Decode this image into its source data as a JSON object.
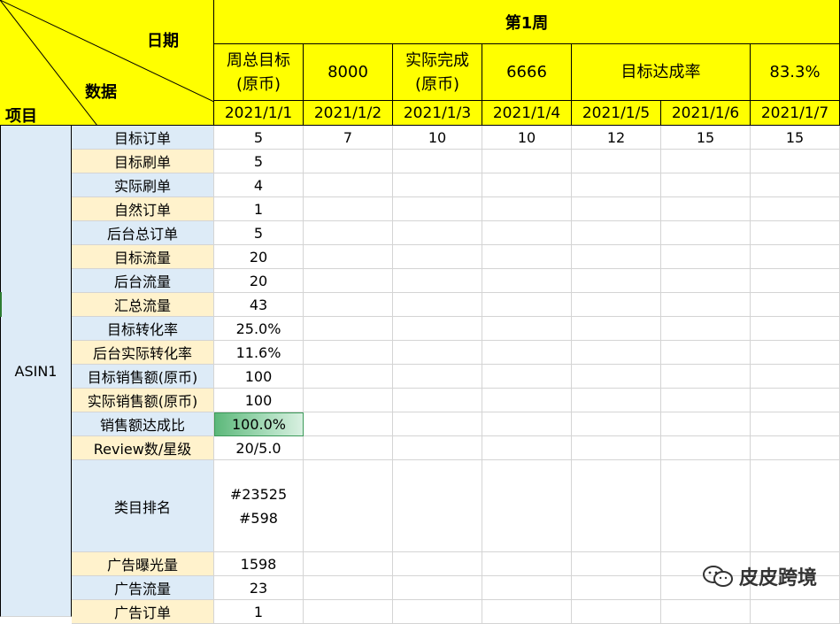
{
  "header": {
    "date_label": "日期",
    "data_label": "数据",
    "project_label": "项目",
    "week_title": "第1周",
    "summary": [
      {
        "label": "周总目标\n(原币)",
        "value": "8000"
      },
      {
        "label": "实际完成\n(原币)",
        "value": "6666"
      },
      {
        "label": "目标达成率",
        "value": "83.3%"
      }
    ],
    "dates": [
      "2021/1/1",
      "2021/1/2",
      "2021/1/3",
      "2021/1/4",
      "2021/1/5",
      "2021/1/6",
      "2021/1/7"
    ]
  },
  "asin_label": "ASIN1",
  "rows": [
    {
      "label": "目标订单",
      "values": [
        "5",
        "7",
        "10",
        "10",
        "12",
        "15",
        "15"
      ]
    },
    {
      "label": "目标刷单",
      "values": [
        "5",
        "",
        "",
        "",
        "",
        "",
        ""
      ]
    },
    {
      "label": "实际刷单",
      "values": [
        "4",
        "",
        "",
        "",
        "",
        "",
        ""
      ]
    },
    {
      "label": "自然订单",
      "values": [
        "1",
        "",
        "",
        "",
        "",
        "",
        ""
      ]
    },
    {
      "label": "后台总订单",
      "values": [
        "5",
        "",
        "",
        "",
        "",
        "",
        ""
      ]
    },
    {
      "label": "目标流量",
      "values": [
        "20",
        "",
        "",
        "",
        "",
        "",
        ""
      ]
    },
    {
      "label": "后台流量",
      "values": [
        "20",
        "",
        "",
        "",
        "",
        "",
        ""
      ]
    },
    {
      "label": "汇总流量",
      "values": [
        "43",
        "",
        "",
        "",
        "",
        "",
        ""
      ]
    },
    {
      "label": "目标转化率",
      "values": [
        "25.0%",
        "",
        "",
        "",
        "",
        "",
        ""
      ]
    },
    {
      "label": "后台实际转化率",
      "values": [
        "11.6%",
        "",
        "",
        "",
        "",
        "",
        ""
      ]
    },
    {
      "label": "目标销售额(原币)",
      "values": [
        "100",
        "",
        "",
        "",
        "",
        "",
        ""
      ]
    },
    {
      "label": "实际销售额(原币)",
      "values": [
        "100",
        "",
        "",
        "",
        "",
        "",
        ""
      ]
    },
    {
      "label": "销售额达成比",
      "values": [
        "100.0%",
        "",
        "",
        "",
        "",
        "",
        ""
      ]
    },
    {
      "label": "Review数/星级",
      "values": [
        "20/5.0",
        "",
        "",
        "",
        "",
        "",
        ""
      ]
    },
    {
      "label": "类目排名",
      "values": [
        "#23525\n#598",
        "",
        "",
        "",
        "",
        "",
        ""
      ]
    },
    {
      "label": "广告曝光量",
      "values": [
        "1598",
        "",
        "",
        "",
        "",
        "",
        ""
      ]
    },
    {
      "label": "广告流量",
      "values": [
        "23",
        "",
        "",
        "",
        "",
        "",
        ""
      ]
    },
    {
      "label": "广告订单",
      "values": [
        "1",
        "",
        "",
        "",
        "",
        "",
        ""
      ]
    }
  ],
  "row_styles": [
    "blue",
    "cream",
    "blue",
    "cream",
    "blue",
    "cream",
    "blue",
    "cream",
    "blue",
    "cream",
    "blue",
    "cream",
    "blue",
    "cream",
    "blue",
    "cream",
    "blue",
    "cream"
  ],
  "selected_cell": {
    "row": 12,
    "col": 0,
    "value_fill_percent": 100
  },
  "watermark": {
    "text": "皮皮跨境",
    "icon": "wechat-icon"
  },
  "colors": {
    "header_yellow": "#ffff00",
    "label_blue": "#ddebf7",
    "label_cream": "#fff2cc",
    "selection_green": "#5cb87a"
  }
}
